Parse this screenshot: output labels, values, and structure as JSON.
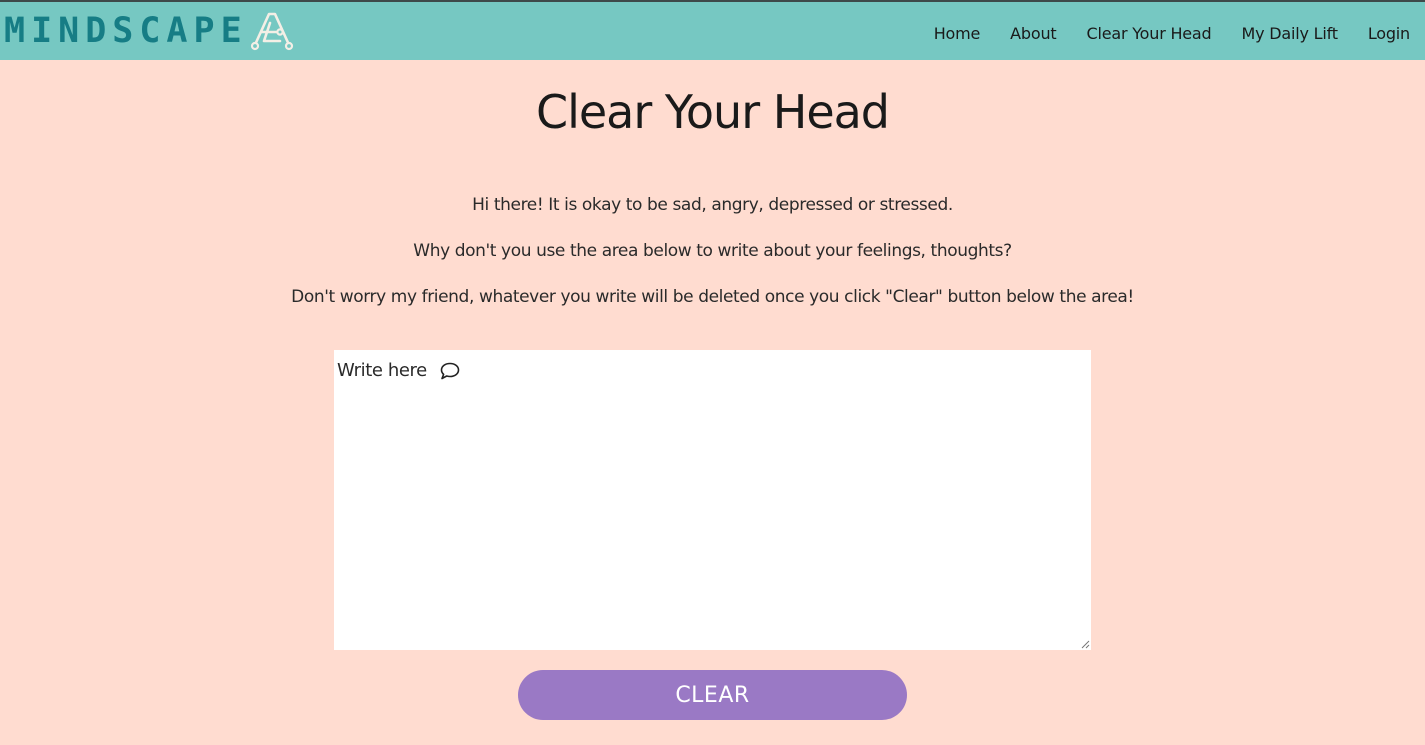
{
  "navbar": {
    "brand": "MINDSCAPE",
    "links": [
      "Home",
      "About",
      "Clear Your Head",
      "My Daily Lift",
      "Login"
    ]
  },
  "main": {
    "title": "Clear Your Head",
    "intro": [
      "Hi there! It is okay to be sad, angry, depressed or stressed.",
      "Why don't you use the area below to write about your feelings, thoughts?",
      "Don't worry my friend, whatever you write will be deleted once you click \"Clear\" button below the area!"
    ],
    "textarea": {
      "placeholder": "Write here",
      "value": ""
    },
    "clear_button": "CLEAR"
  },
  "colors": {
    "background": "#ffdcd0",
    "navbar": "#76c8c2",
    "brand": "#167d85",
    "button": "#9a79c5"
  }
}
